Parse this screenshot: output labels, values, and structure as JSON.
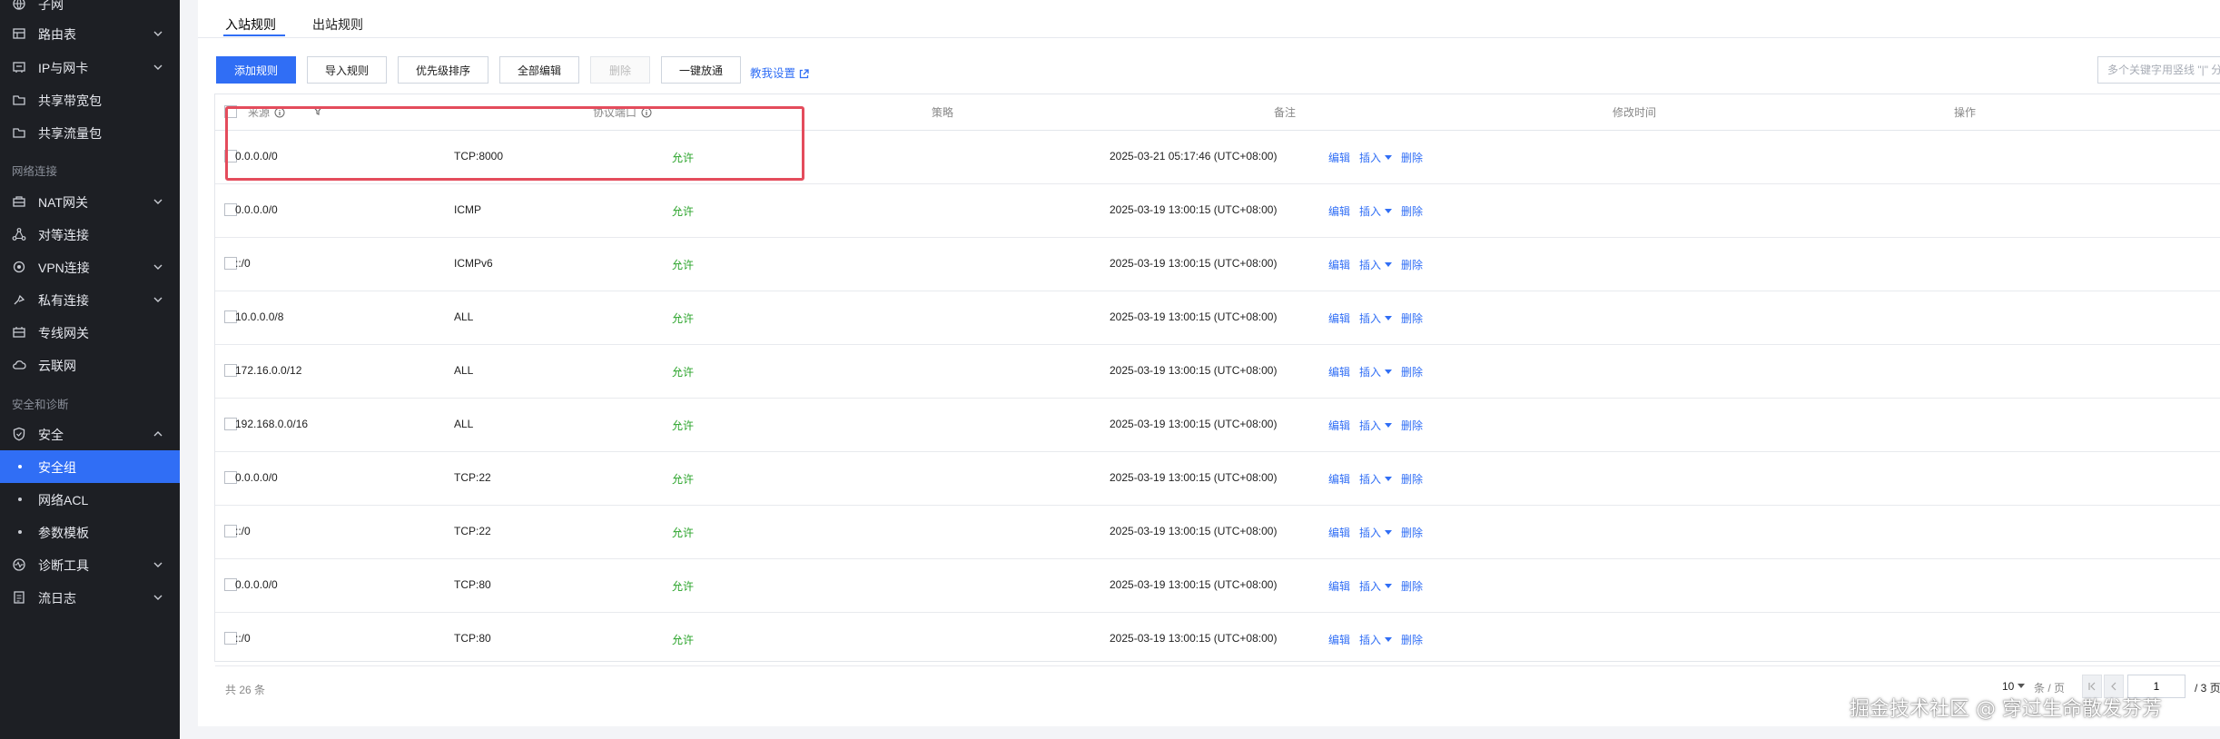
{
  "sidebar": {
    "items": [
      {
        "label": "子网",
        "icon": "globe-icon"
      },
      {
        "label": "路由表",
        "icon": "route-table-icon",
        "chevron": "down"
      },
      {
        "label": "IP与网卡",
        "icon": "network-card-icon",
        "chevron": "down"
      },
      {
        "label": "共享带宽包",
        "icon": "bandwidth-icon"
      },
      {
        "label": "共享流量包",
        "icon": "traffic-icon"
      },
      {
        "label": "NAT网关",
        "icon": "nat-gateway-icon",
        "chevron": "down"
      },
      {
        "label": "对等连接",
        "icon": "peering-icon"
      },
      {
        "label": "VPN连接",
        "icon": "vpn-icon",
        "chevron": "down"
      },
      {
        "label": "私有连接",
        "icon": "private-link-icon",
        "chevron": "down"
      },
      {
        "label": "专线网关",
        "icon": "dedicated-gateway-icon"
      },
      {
        "label": "云联网",
        "icon": "cloud-network-icon"
      },
      {
        "label": "安全",
        "icon": "shield-icon",
        "chevron": "up"
      },
      {
        "label": "安全组",
        "sub": true,
        "active": true
      },
      {
        "label": "网络ACL",
        "sub": true
      },
      {
        "label": "参数模板",
        "sub": true
      },
      {
        "label": "诊断工具",
        "icon": "diagnosis-icon",
        "chevron": "down"
      },
      {
        "label": "流日志",
        "icon": "flow-log-icon",
        "chevron": "down"
      }
    ],
    "groups": {
      "network": "网络连接",
      "security": "安全和诊断"
    }
  },
  "tabs": {
    "inbound": "入站规则",
    "outbound": "出站规则"
  },
  "toolbar": {
    "add": "添加规则",
    "import": "导入规则",
    "priority": "优先级排序",
    "edit_all": "全部编辑",
    "delete": "删除",
    "one_click": "一键放通",
    "tutorial": "教我设置",
    "search_placeholder": "多个关键字用竖线 \"|\" 分隔，多个过滤标签用回车键分隔"
  },
  "table": {
    "headers": {
      "source": "来源",
      "protocol_port": "协议端口",
      "policy": "策略",
      "remark": "备注",
      "modified": "修改时间",
      "actions": "操作"
    },
    "rows": [
      {
        "source": "0.0.0.0/0",
        "protocol": "TCP:8000",
        "policy": "允许",
        "remark": "",
        "modified": "2025-03-21 05:17:46 (UTC+08:00)"
      },
      {
        "source": "0.0.0.0/0",
        "protocol": "ICMP",
        "policy": "允许",
        "remark": "",
        "modified": "2025-03-19 13:00:15 (UTC+08:00)"
      },
      {
        "source": "::/0",
        "protocol": "ICMPv6",
        "policy": "允许",
        "remark": "",
        "modified": "2025-03-19 13:00:15 (UTC+08:00)"
      },
      {
        "source": "10.0.0.0/8",
        "protocol": "ALL",
        "policy": "允许",
        "remark": "",
        "modified": "2025-03-19 13:00:15 (UTC+08:00)"
      },
      {
        "source": "172.16.0.0/12",
        "protocol": "ALL",
        "policy": "允许",
        "remark": "",
        "modified": "2025-03-19 13:00:15 (UTC+08:00)"
      },
      {
        "source": "192.168.0.0/16",
        "protocol": "ALL",
        "policy": "允许",
        "remark": "",
        "modified": "2025-03-19 13:00:15 (UTC+08:00)"
      },
      {
        "source": "0.0.0.0/0",
        "protocol": "TCP:22",
        "policy": "允许",
        "remark": "",
        "modified": "2025-03-19 13:00:15 (UTC+08:00)"
      },
      {
        "source": "::/0",
        "protocol": "TCP:22",
        "policy": "允许",
        "remark": "",
        "modified": "2025-03-19 13:00:15 (UTC+08:00)"
      },
      {
        "source": "0.0.0.0/0",
        "protocol": "TCP:80",
        "policy": "允许",
        "remark": "",
        "modified": "2025-03-19 13:00:15 (UTC+08:00)"
      },
      {
        "source": "::/0",
        "protocol": "TCP:80",
        "policy": "允许",
        "remark": "",
        "modified": "2025-03-19 13:00:15 (UTC+08:00)"
      }
    ],
    "row_actions": {
      "edit": "编辑",
      "insert": "插入",
      "delete": "删除"
    }
  },
  "pagination": {
    "total": "共 26 条",
    "page_size": "10",
    "page_size_suffix": "条 / 页",
    "current_page": "1",
    "total_pages": "/ 3 页"
  },
  "watermark": "掘金技术社区 @ 穿过生命散发芬芳",
  "colors": {
    "accent": "#306ef5",
    "allow": "#29a329",
    "highlight": "#e44c5c",
    "sidebar_bg": "#1d1f24"
  }
}
